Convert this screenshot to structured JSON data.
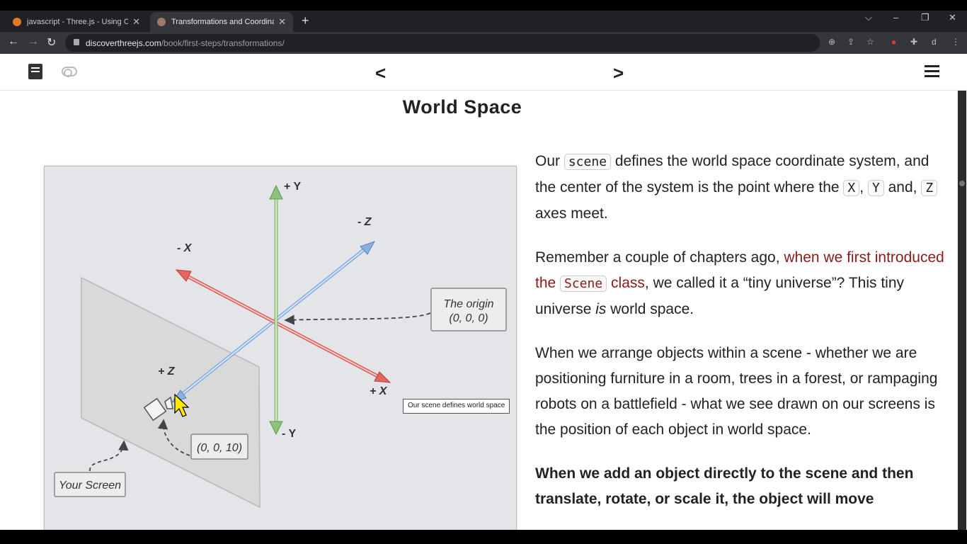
{
  "browser": {
    "tabs": [
      {
        "title": "javascript - Three.js - Using Cube",
        "active": false
      },
      {
        "title": "Transformations and Coordinate",
        "active": true
      }
    ],
    "new_tab": "+",
    "url_domain": "discoverthreejs.com",
    "url_path": "/book/first-steps/transformations/",
    "profile": "d"
  },
  "page": {
    "title": "World Space"
  },
  "figure": {
    "axis_labels": {
      "pos_y": "+ Y",
      "neg_y": "- Y",
      "pos_x": "+ X",
      "neg_x": "- X",
      "pos_z": "+ Z",
      "neg_z": "- Z"
    },
    "origin_label": "The origin",
    "origin_coords": "(0, 0, 0)",
    "camera_coords": "(0, 0, 10)",
    "screen_label": "Your Screen",
    "tooltip": "Our scene defines world space",
    "colors": {
      "x_axis": "#e0665f",
      "y_axis": "#8cc27a",
      "z_axis": "#8ab0e0",
      "plane": "#d9d9d9"
    }
  },
  "content": {
    "p1": {
      "a": "Our ",
      "code1": "scene",
      "b": " defines the world space coordinate system, and the center of the system is the point where the ",
      "x": "X",
      "comma": ",",
      "y": "Y",
      "and": " and, ",
      "z": "Z",
      "c": " axes meet."
    },
    "p2": {
      "a": "Remember a couple of chapters ago, ",
      "link1": "when we first introduced the ",
      "code": "Scene",
      "link2": " class",
      "b": ", we called it a “tiny universe”? This tiny universe ",
      "em": "is",
      "c": " world space."
    },
    "p3": "When we arrange objects within a scene - whether we are positioning furniture in a room, trees in a forest, or rampaging robots on a battlefield - what we see drawn on our screens is the position of each object in world space.",
    "p4": "When we add an object directly to the scene and then translate, rotate, or scale it, the object will move"
  }
}
